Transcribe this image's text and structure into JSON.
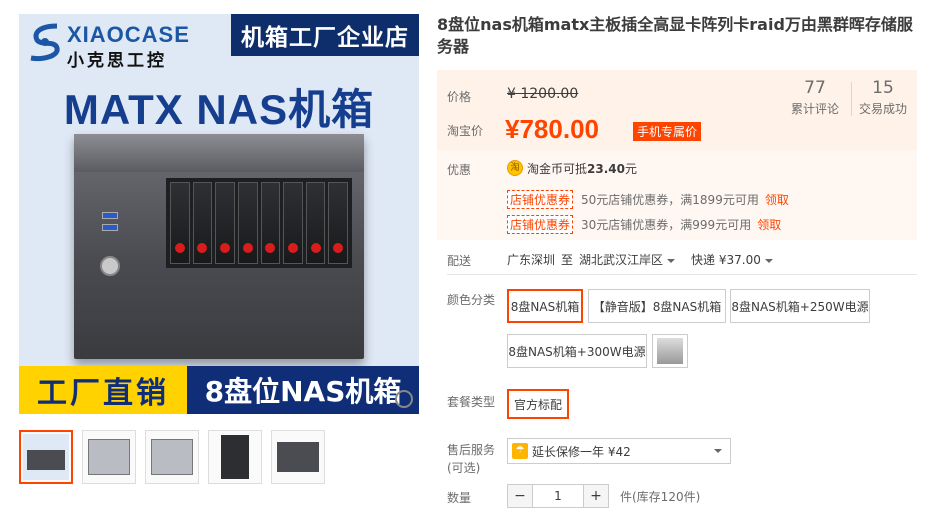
{
  "product_image": {
    "logo_en": "XIAOCASE",
    "logo_cn": "小克思工控",
    "store_tag": "机箱工厂企业店",
    "headline": "MATX NAS机箱",
    "banner_left": "工厂直销",
    "banner_right": "8盘位NAS机箱",
    "zoom_icon": "magnifier-icon"
  },
  "thumbnails": [
    {
      "name": "thumb-main",
      "selected": true
    },
    {
      "name": "thumb-interior",
      "selected": false
    },
    {
      "name": "thumb-open",
      "selected": false
    },
    {
      "name": "thumb-front",
      "selected": false
    },
    {
      "name": "thumb-side",
      "selected": false
    }
  ],
  "title": "8盘位nas机箱matx主板插全高显卡阵列卡raid万由黑群晖存储服务器",
  "price": {
    "label_price": "价格",
    "original": "¥ 1200.00",
    "label_taobao": "淘宝价",
    "current": "¥780.00",
    "mobile_badge": "手机专属价"
  },
  "stats": {
    "reviews_count": "77",
    "reviews_label": "累计评论",
    "sales_count": "15",
    "sales_label": "交易成功"
  },
  "promo": {
    "label": "优惠",
    "coin_icon": "taobao-coin-icon",
    "coin_glyph": "淘",
    "coin_text_prefix": "淘金币可抵",
    "coin_amount": "23.40",
    "coin_suffix": "元",
    "coupons": [
      {
        "tag": "店铺优惠券",
        "text": "50元店铺优惠券，满1899元可用",
        "link": "领取"
      },
      {
        "tag": "店铺优惠券",
        "text": "30元店铺优惠券，满999元可用",
        "link": "领取"
      }
    ]
  },
  "shipping": {
    "label": "配送",
    "from": "广东深圳",
    "to_word": "至",
    "to": "湖北武汉江岸区",
    "method": "快递 ¥37.00"
  },
  "color": {
    "label": "颜色分类",
    "options": [
      "8盘NAS机箱",
      "【静音版】8盘NAS机箱",
      "8盘NAS机箱+250W电源",
      "8盘NAS机箱+300W电源"
    ],
    "selected": "8盘NAS机箱"
  },
  "package": {
    "label": "套餐类型",
    "option": "官方标配"
  },
  "after_sale": {
    "label": "售后服务",
    "sub_label": "(可选)",
    "value": "延长保修一年 ¥42"
  },
  "quantity": {
    "label": "数量",
    "minus": "−",
    "value": "1",
    "plus": "+",
    "stock": "件(库存120件)"
  }
}
